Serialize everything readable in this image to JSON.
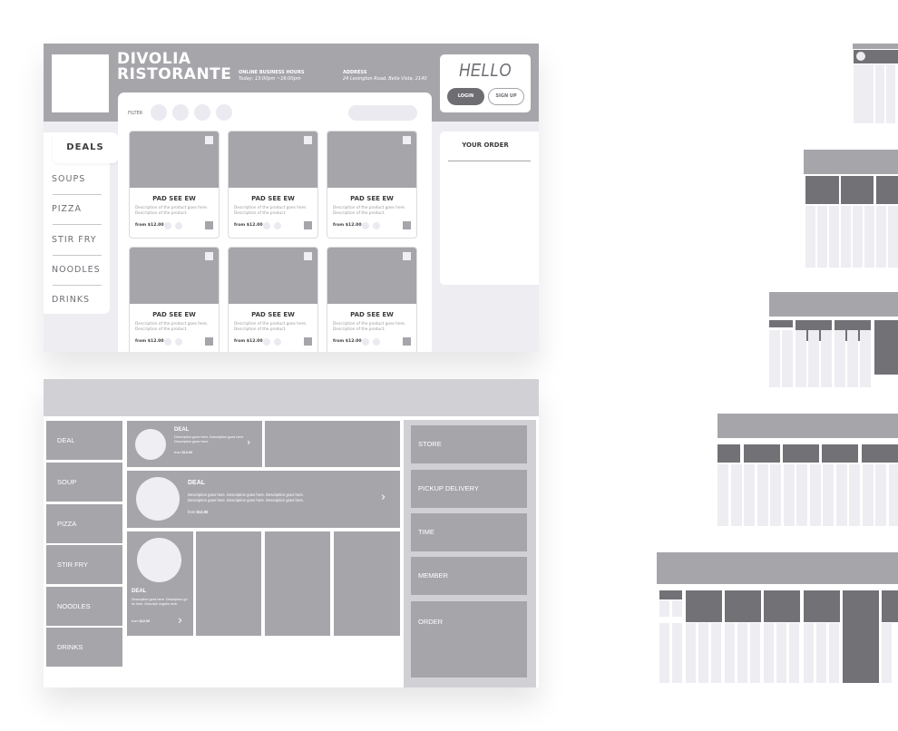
{
  "wireframe_desktop": {
    "brand": {
      "line1": "DIVOLIA",
      "line2": "RISTORANTE"
    },
    "business_hours": {
      "label": "ONLINE BUSINESS HOURS",
      "value": "Today: 13:00pm ~16:00pm"
    },
    "address": {
      "label": "ADDRESS",
      "value": "24 Lexington Road, Bella Vista, 2140"
    },
    "greeting": "HELLO",
    "login_label": "LOGIN",
    "signup_label": "SIGN UP",
    "filter_label": "FILTER",
    "sidebar": {
      "active": "DEALS",
      "items": [
        "SOUPS",
        "PIZZA",
        "STIR FRY",
        "NOODLES",
        "DRINKS"
      ]
    },
    "products": [
      {
        "name": "PAD SEE EW",
        "description": "Description of the product goes here.  Description of the product.",
        "price": "from $12.00"
      },
      {
        "name": "PAD SEE EW",
        "description": "Description of the product goes here.  Description of the product.",
        "price": "from $12.00"
      },
      {
        "name": "PAD SEE EW",
        "description": "Description of the product goes here.  Description of the product.",
        "price": "from $12.00"
      },
      {
        "name": "PAD SEE EW",
        "description": "Description of the product goes here.  Description of the product.",
        "price": "from $12.00"
      },
      {
        "name": "PAD SEE EW",
        "description": "Description of the product goes here.  Description of the product.",
        "price": "from $12.00"
      },
      {
        "name": "PAD SEE EW",
        "description": "Description of the product goes here.  Description of the product.",
        "price": "from $12.00"
      }
    ],
    "order_title": "YOUR ORDER"
  },
  "wireframe_kiosk": {
    "categories": [
      "DEAL",
      "SOUP",
      "PIZZA",
      "STIR FRY",
      "NOODLES",
      "DRINKS"
    ],
    "deal_small": {
      "title": "DEAL",
      "description": "Description goes here. Description goes here. Description goes here.",
      "price_prefix": "from",
      "price": "$12.00"
    },
    "deal_wide": {
      "title": "DEAL",
      "description_line1": "Description goes here. Description goes here. Description goes here.",
      "description_line2": "Description goes here. Description goes here. Description goes here.",
      "price_prefix": "from",
      "price": "$12.00"
    },
    "deal_tall": {
      "title": "DEAL",
      "description": "Description goes here. Description goes here. Descripti ongoes here.",
      "price_prefix": "from",
      "price": "$12.00"
    },
    "right_panel": [
      "STORE",
      "PICKUP DELIVERY",
      "TIME",
      "MEMBER",
      "ORDER"
    ]
  },
  "colors": {
    "mid_gray": "#a6a5aa",
    "dark_gray": "#727176",
    "light_gray": "#eeeef2",
    "bar_gray": "#d1d0d5"
  }
}
